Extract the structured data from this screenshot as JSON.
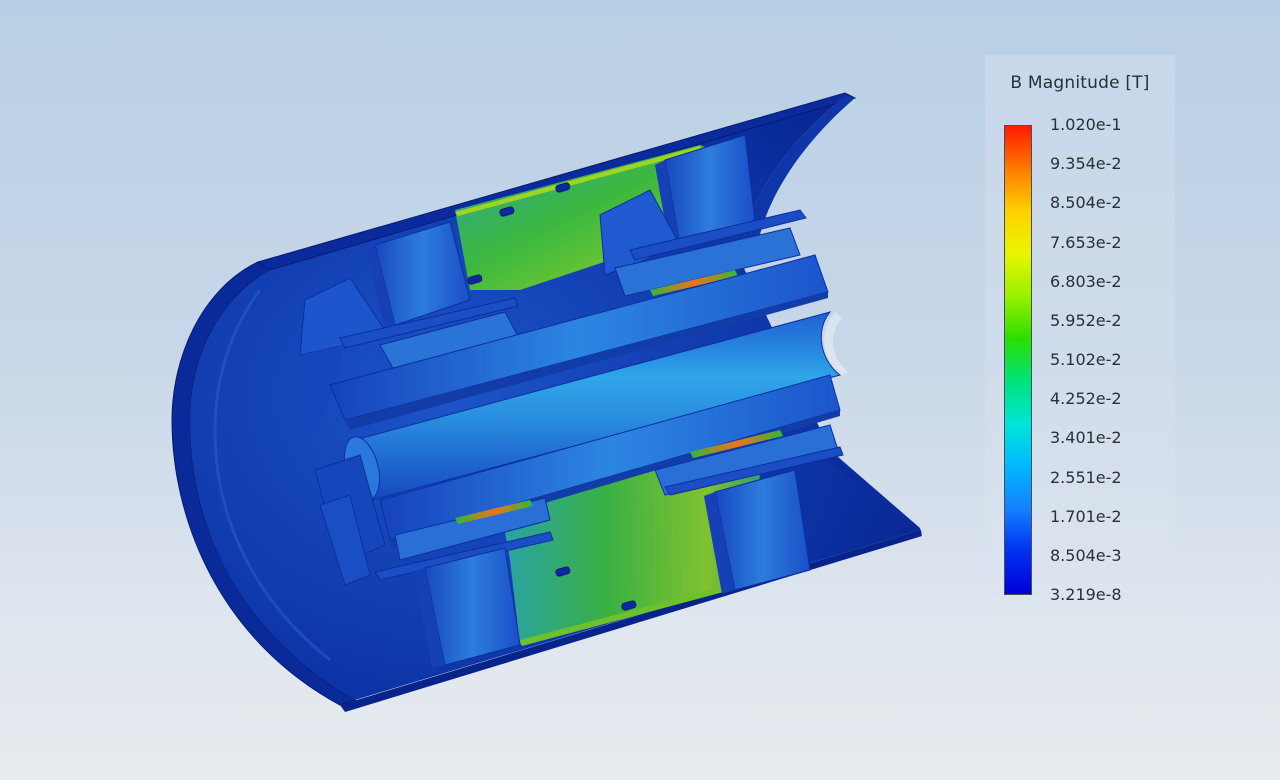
{
  "legend": {
    "title": "B Magnitude [T]",
    "labels": [
      "1.020e-1",
      "9.354e-2",
      "8.504e-2",
      "7.653e-2",
      "6.803e-2",
      "5.952e-2",
      "5.102e-2",
      "4.252e-2",
      "3.401e-2",
      "2.551e-2",
      "1.701e-2",
      "8.504e-3",
      "3.219e-8"
    ],
    "colors": [
      "#ff1a00",
      "#ff7a00",
      "#ffd000",
      "#e8f500",
      "#9af000",
      "#2adf00",
      "#00e27a",
      "#00e6d8",
      "#00b8ff",
      "#1580ff",
      "#0030f0",
      "#0000d8"
    ]
  },
  "scene": {
    "model": "cylindrical-magnet-cutaway",
    "colors": {
      "deep_blue": "#0a2a9a",
      "mid_blue": "#1f5ad2",
      "light_blue": "#2f8de6",
      "cyan": "#2fc6e8",
      "green": "#35b83a",
      "yellow_green": "#9fd520",
      "hot": "#f07a1a"
    }
  }
}
